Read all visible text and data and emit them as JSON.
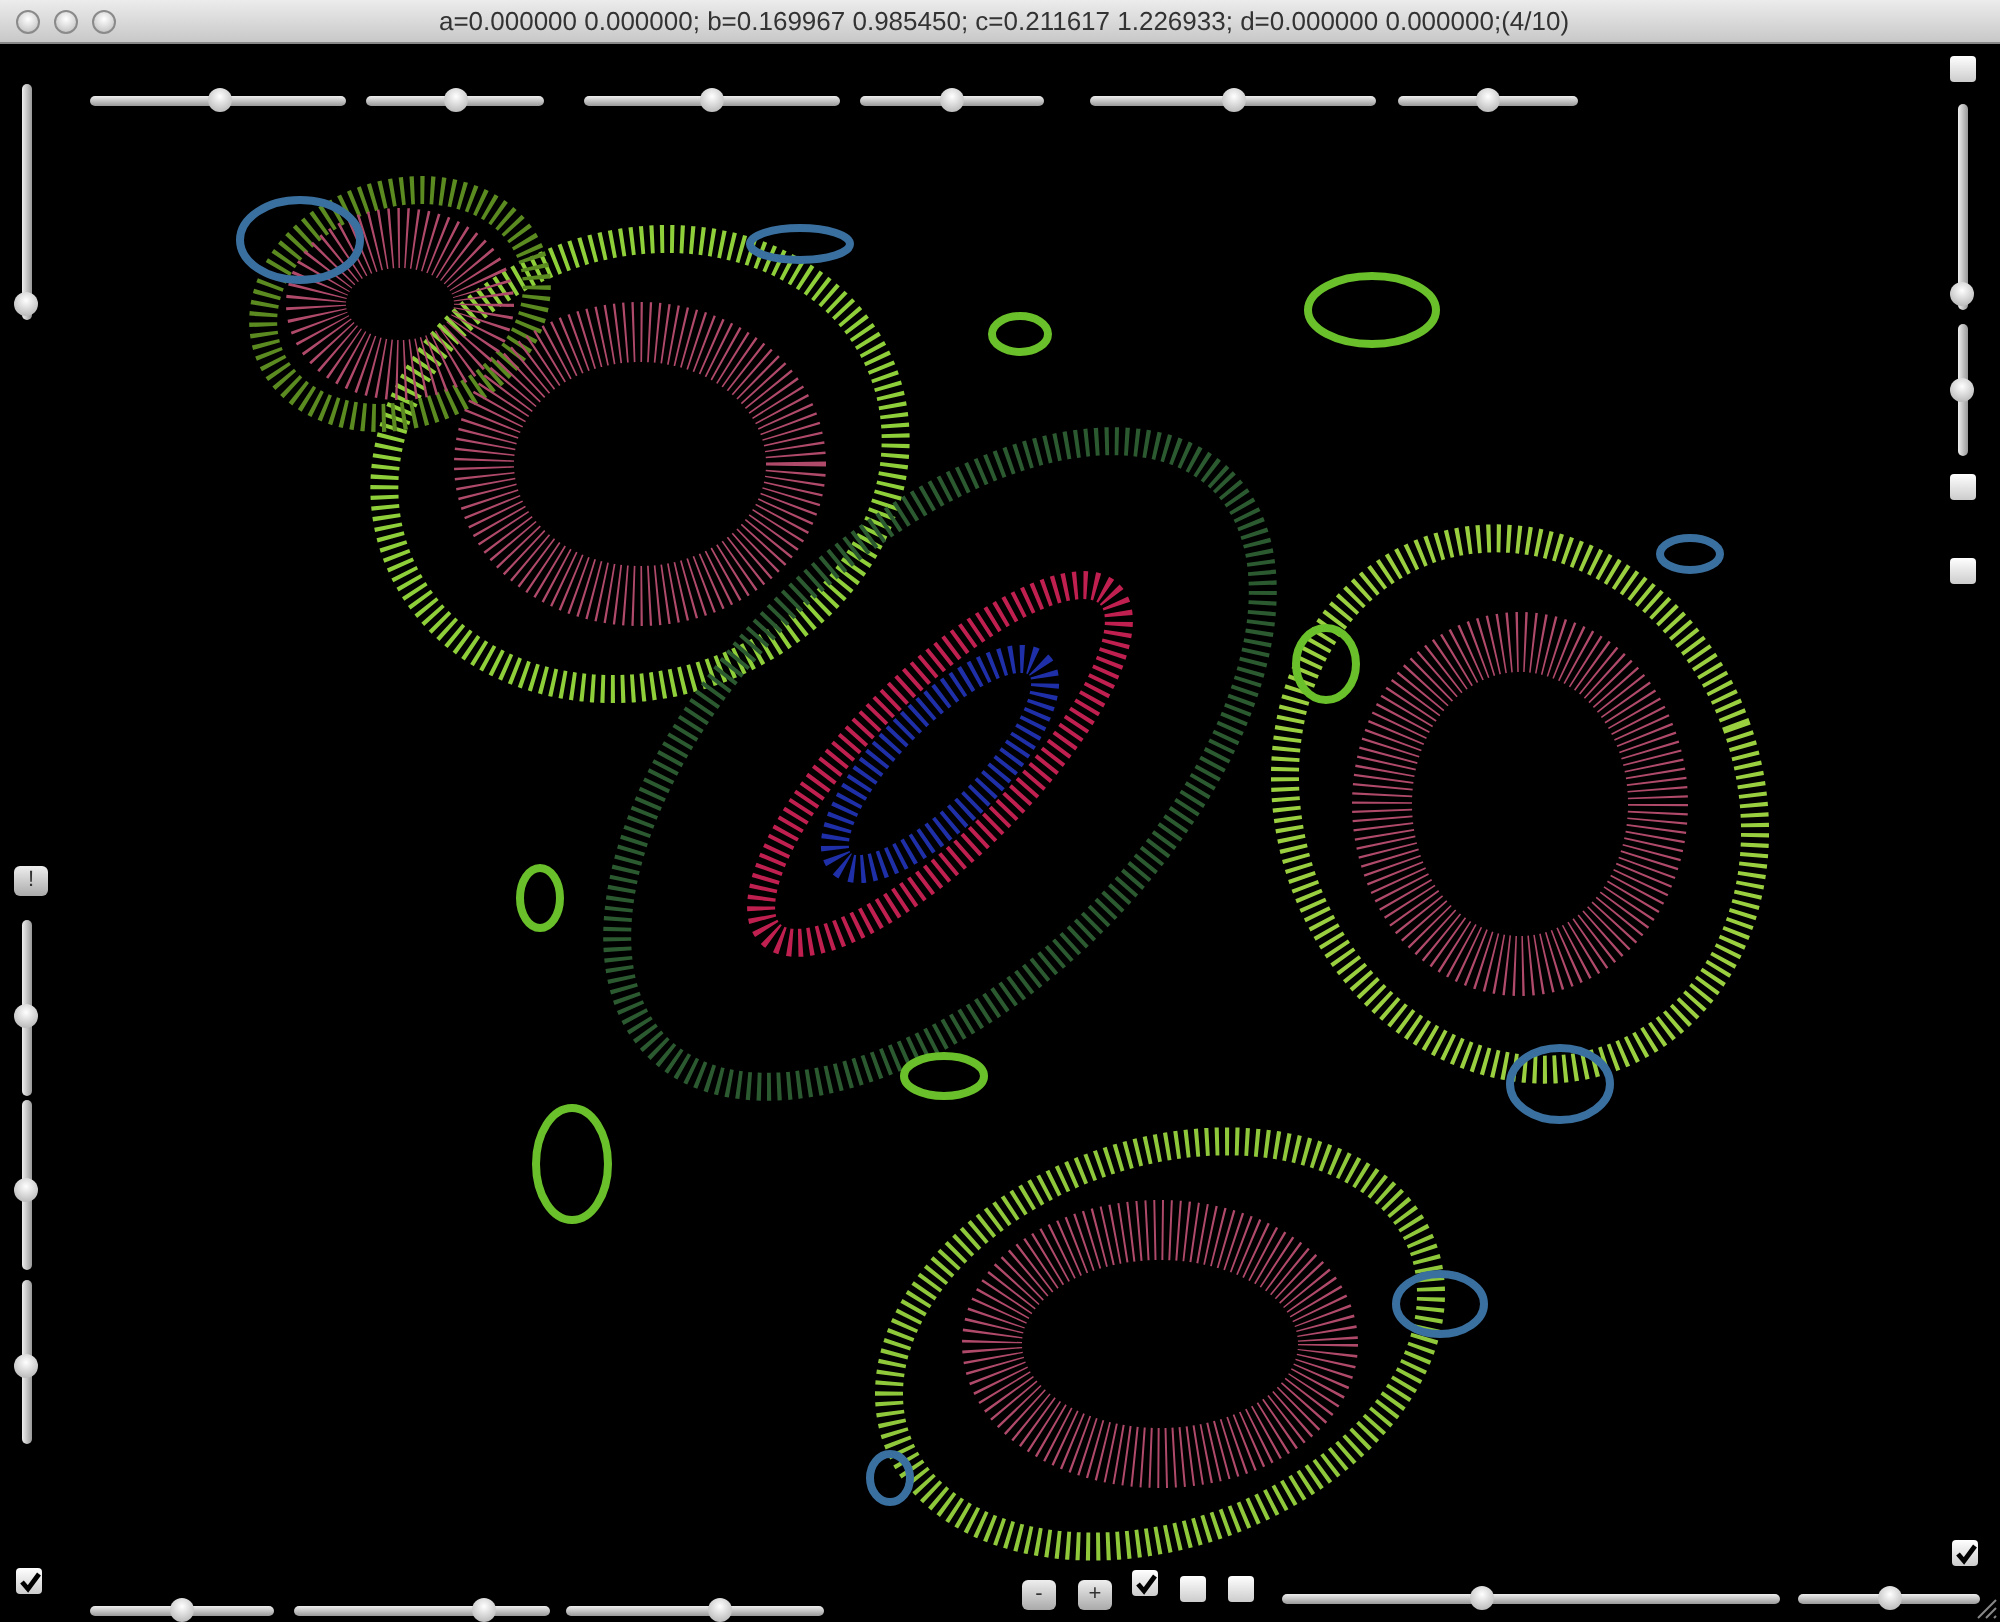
{
  "window": {
    "title": "a=0.000000 0.000000; b=0.169967 0.985450; c=0.211617 1.226933; d=0.000000 0.000000;(4/10)"
  },
  "top_controls": [
    {
      "kind": "slider",
      "level": 0.51
    },
    {
      "kind": "slider",
      "level": 0.5
    },
    {
      "kind": "slider",
      "level": 0.5
    },
    {
      "kind": "slider",
      "level": 0.5
    },
    {
      "kind": "slider",
      "level": 0.5
    },
    {
      "kind": "slider",
      "level": 0.5
    }
  ],
  "right_controls": [
    {
      "kind": "checkbox",
      "checked": false
    },
    {
      "kind": "slider",
      "level": 0.08
    },
    {
      "kind": "slider",
      "level": 0.5
    },
    {
      "kind": "checkbox",
      "checked": false
    },
    {
      "kind": "checkbox",
      "checked": false
    }
  ],
  "left_controls": [
    {
      "kind": "slider",
      "level": 0.07
    },
    {
      "kind": "button",
      "label": "!"
    },
    {
      "kind": "slider",
      "level": 0.45
    },
    {
      "kind": "slider",
      "level": 0.47
    },
    {
      "kind": "slider",
      "level": 0.48
    },
    {
      "kind": "checkbox",
      "checked": true
    }
  ],
  "bottom_controls": [
    {
      "kind": "slider",
      "level": 0.5
    },
    {
      "kind": "slider",
      "level": 0.74
    },
    {
      "kind": "slider",
      "level": 0.6
    },
    {
      "kind": "button",
      "label": "-"
    },
    {
      "kind": "button",
      "label": "+"
    },
    {
      "kind": "checkbox",
      "checked": true
    },
    {
      "kind": "checkbox",
      "checked": false
    },
    {
      "kind": "checkbox",
      "checked": false
    },
    {
      "kind": "slider",
      "level": 0.4
    },
    {
      "kind": "slider",
      "level": 0.5
    },
    {
      "kind": "checkbox",
      "checked": true
    }
  ]
}
